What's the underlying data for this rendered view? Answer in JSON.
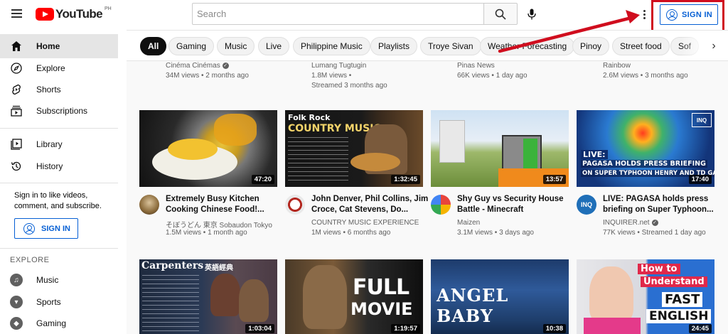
{
  "header": {
    "logo_text": "YouTube",
    "country": "PH",
    "search_placeholder": "Search",
    "signin_label": "SIGN IN"
  },
  "sidebar": {
    "items": [
      {
        "label": "Home",
        "icon": "home-icon"
      },
      {
        "label": "Explore",
        "icon": "compass-icon"
      },
      {
        "label": "Shorts",
        "icon": "shorts-icon"
      },
      {
        "label": "Subscriptions",
        "icon": "subscriptions-icon"
      },
      {
        "label": "Library",
        "icon": "library-icon"
      },
      {
        "label": "History",
        "icon": "history-icon"
      }
    ],
    "signin_prompt": "Sign in to like videos, comment, and subscribe.",
    "signin_label": "SIGN IN",
    "explore_heading": "EXPLORE",
    "explore_items": [
      {
        "label": "Music",
        "icon": "music-icon"
      },
      {
        "label": "Sports",
        "icon": "trophy-icon"
      },
      {
        "label": "Gaming",
        "icon": "gaming-icon"
      }
    ]
  },
  "chips": [
    "All",
    "Gaming",
    "Music",
    "Live",
    "Philippine Music",
    "Playlists",
    "Troye Sivan",
    "Weather Forecasting",
    "Pinoy",
    "Street food",
    "Sof"
  ],
  "row0": [
    {
      "channel": "Cinéma Cinémas",
      "verified": true,
      "stats": [
        "34M views • 2 months ago"
      ]
    },
    {
      "channel": "Lumang Tugtugin",
      "verified": false,
      "stats": [
        "1.8M views •",
        "Streamed 3 months ago"
      ]
    },
    {
      "channel": "Pinas News",
      "verified": false,
      "stats": [
        "66K views • 1 day ago"
      ]
    },
    {
      "channel": "Rainbow",
      "verified": false,
      "stats": [
        "2.6M views • 3 months ago"
      ]
    }
  ],
  "row1": [
    {
      "title": "Extremely Busy Kitchen Cooking Chinese Food!...",
      "channel": "そぼうどん 東京 Sobaudon Tokyo",
      "verified": false,
      "stats": "1.5M views • 1 month ago",
      "duration": "47:20"
    },
    {
      "title": "John Denver, Phil Collins, Jim Croce, Cat Stevens, Do...",
      "channel": "COUNTRY MUSIC EXPERIENCE",
      "verified": false,
      "stats": "1M views • 6 months ago",
      "duration": "1:32:45",
      "thumb_text_1": "Folk Rock",
      "thumb_text_2": "COUNTRY MUSIC"
    },
    {
      "title": "Shy Guy vs Security House Battle - Minecraft",
      "channel": "Maizen",
      "verified": false,
      "stats": "3.1M views • 3 days ago",
      "duration": "13:57"
    },
    {
      "title": "LIVE: PAGASA holds press briefing on Super Typhoon...",
      "channel": "INQUIRER.net",
      "verified": true,
      "stats": "77K views • Streamed 1 day ago",
      "duration": "17:40",
      "thumb_badge": "LIVE:",
      "thumb_text_1": "PAGASA HOLDS PRESS BRIEFING",
      "thumb_text_2": "ON SUPER TYPHOON HENRY AND TD GARDO",
      "thumb_logo": "INQ",
      "avatar_text": "INQ"
    }
  ],
  "row2": [
    {
      "duration": "1:03:04",
      "thumb_text_1": "Carpenters",
      "thumb_text_2": "英語經典"
    },
    {
      "duration": "1:19:57",
      "thumb_text_1": "FULL",
      "thumb_text_2": "MOVIE"
    },
    {
      "duration": "10:38",
      "thumb_text_1": "ANGEL BABY"
    },
    {
      "duration": "24:45",
      "thumb_text_1": "How to",
      "thumb_text_2": "Understand",
      "thumb_text_3": "FAST",
      "thumb_text_4": "ENGLISH"
    }
  ],
  "colors": {
    "accent_blue": "#065fd4",
    "annotation_red": "#d00d1e",
    "logo_red": "#ff0000"
  }
}
